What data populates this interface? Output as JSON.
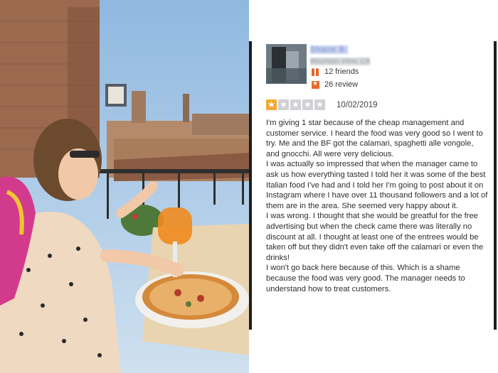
{
  "review": {
    "user": {
      "name": "Shane B.",
      "location": "Mountain View, CA",
      "friends": "12 friends",
      "reviews": "26 review"
    },
    "rating": {
      "stars_filled": 1,
      "stars_total": 5
    },
    "date": "10/02/2019",
    "paragraphs": [
      "I'm giving 1 star because of the cheap management and customer service. I heard the food was very good so I went to try. Me and the BF got the calamari, spaghetti alle vongole, and gnocchi. All were very delicious.",
      "I was actually so impressed that when the manager came to ask us how everything tasted I told her it was some of the best Italian food I've had and I told her I'm going to post about it on Instagram where I have over 11 thousand followers and a lot of them are in the area. She seemed very happy about it.",
      "I was wrong. I thought that she would be greatful for the free advertising but when the check came there was literally no discount at all. I thought at least one of the entrees would be taken off but they didn't even take off the calamari or even the drinks!",
      "I won't go back here because of this. Which is a shame because the food was very good. The manager needs to understand how to treat customers."
    ]
  },
  "colors": {
    "star_on": "#f0a933",
    "star_off": "#cfd1d4",
    "icon_orange": "#e8692a",
    "text": "#2e2e2e"
  },
  "icons": {
    "friends": "friends-icon",
    "review": "review-count-icon",
    "star": "star-icon"
  }
}
